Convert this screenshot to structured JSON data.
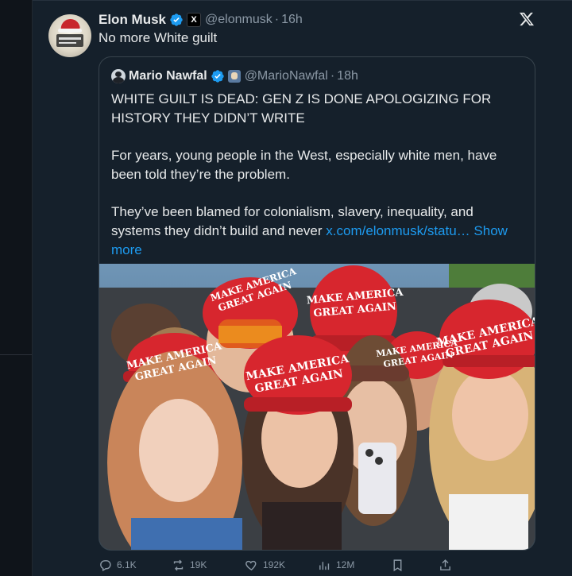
{
  "post": {
    "author_name": "Elon Musk",
    "author_handle": "@elonmusk",
    "time": "16h",
    "affiliation_badge": "X",
    "text": "No more White guilt",
    "close_icon": "x-logo-icon"
  },
  "quote": {
    "author_name": "Mario Nawfal",
    "author_handle": "@MarioNawfal",
    "time": "18h",
    "headline": "WHITE GUILT IS DEAD: GEN Z IS DONE APOLOGIZING FOR HISTORY THEY DIDN’T WRITE",
    "paragraph_1": "For years, young people in the West, especially white men, have been told they’re the problem.",
    "paragraph_2": "They’ve been blamed for colonialism, slavery, inequality, and systems they didn’t build and never",
    "link_text": "x.com/elonmusk/statu…",
    "show_more": "Show more"
  },
  "photo": {
    "cap_lines": [
      "MAKE AMERICA",
      "GREAT AGAIN"
    ]
  },
  "actions": {
    "replies": "6.1K",
    "reposts": "19K",
    "likes": "192K",
    "views": "12M"
  },
  "colors": {
    "background": "#15202b",
    "text": "#e7e9ea",
    "muted": "#8b98a5",
    "link": "#1d9bf0",
    "verified": "#1d9bf0",
    "cap_red": "#d7262e"
  }
}
